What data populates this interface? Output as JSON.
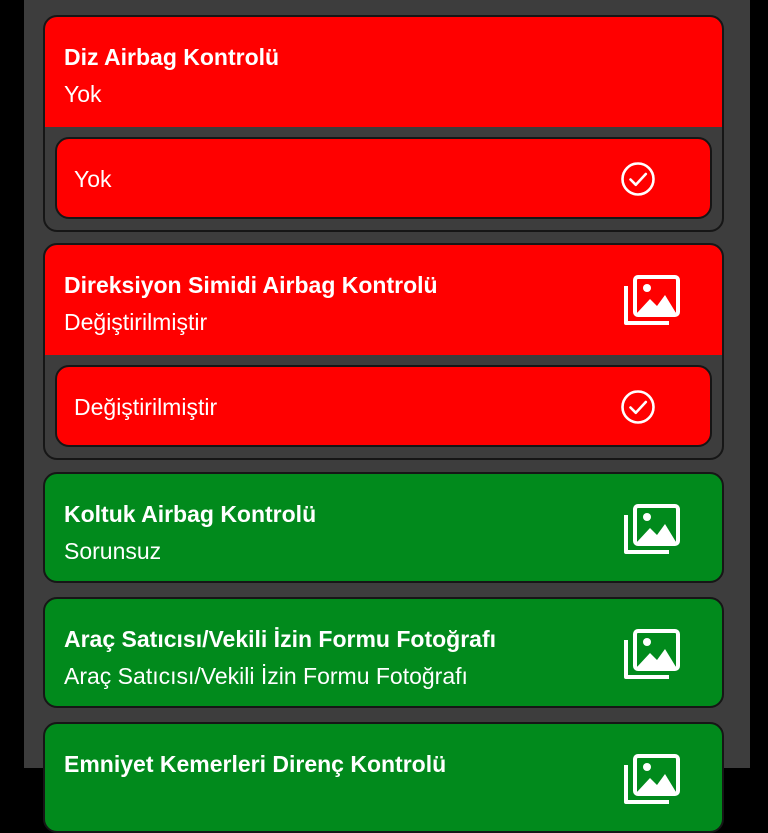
{
  "colors": {
    "fail": "#ff0000",
    "pass": "#018a1c",
    "panel": "#3d3d3d",
    "text": "#ffffff"
  },
  "items": [
    {
      "title": "Diz Airbag Kontrolü",
      "value": "Yok",
      "status": "fail",
      "has_photo": false,
      "expanded": true,
      "options": [
        {
          "label": "Yok",
          "icon": "check-circle-icon"
        }
      ]
    },
    {
      "title": "Direksiyon Simidi Airbag Kontrolü",
      "value": "Değiştirilmiştir",
      "status": "fail",
      "has_photo": true,
      "photo_icon": "gallery-icon",
      "expanded": true,
      "options": [
        {
          "label": "Değiştirilmiştir",
          "icon": "check-circle-icon"
        }
      ]
    },
    {
      "title": "Koltuk Airbag Kontrolü",
      "value": "Sorunsuz",
      "status": "pass",
      "has_photo": true,
      "photo_icon": "gallery-icon",
      "expanded": false
    },
    {
      "title": "Araç Satıcısı/Vekili İzin Formu Fotoğrafı",
      "value": "Araç Satıcısı/Vekili İzin Formu Fotoğrafı",
      "status": "pass",
      "has_photo": true,
      "photo_icon": "gallery-icon",
      "expanded": false
    },
    {
      "title": "Emniyet Kemerleri Direnç Kontrolü",
      "status": "pass",
      "has_photo": true,
      "photo_icon": "gallery-icon",
      "expanded": false
    }
  ]
}
